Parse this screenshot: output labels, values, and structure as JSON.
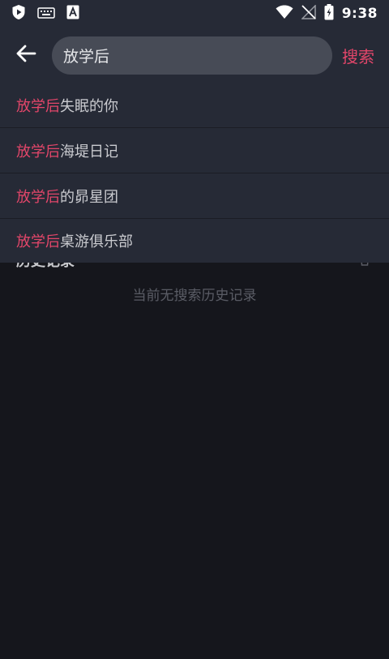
{
  "status_bar": {
    "time": "9:38",
    "icons": [
      "shield-play-icon",
      "keyboard-icon",
      "font-a-icon",
      "wifi-icon",
      "no-signal-icon",
      "battery-charging-icon"
    ]
  },
  "header": {
    "back_icon": "arrow-left-icon",
    "search_value": "放学后",
    "search_button_label": "搜索"
  },
  "suggestions": [
    {
      "highlight": "放学后",
      "rest": "失眠的你"
    },
    {
      "highlight": "放学后",
      "rest": "海堤日记"
    },
    {
      "highlight": "放学后",
      "rest": "的昴星团"
    },
    {
      "highlight": "放学后",
      "rest": "桌游俱乐部"
    }
  ],
  "history": {
    "title": "历史记录",
    "empty_text": "当前无搜索历史记录",
    "clear_icon": "trash-icon"
  },
  "colors": {
    "accent": "#e3466a",
    "panel": "#262a36",
    "background": "#15161c",
    "search_box": "#474b56"
  }
}
